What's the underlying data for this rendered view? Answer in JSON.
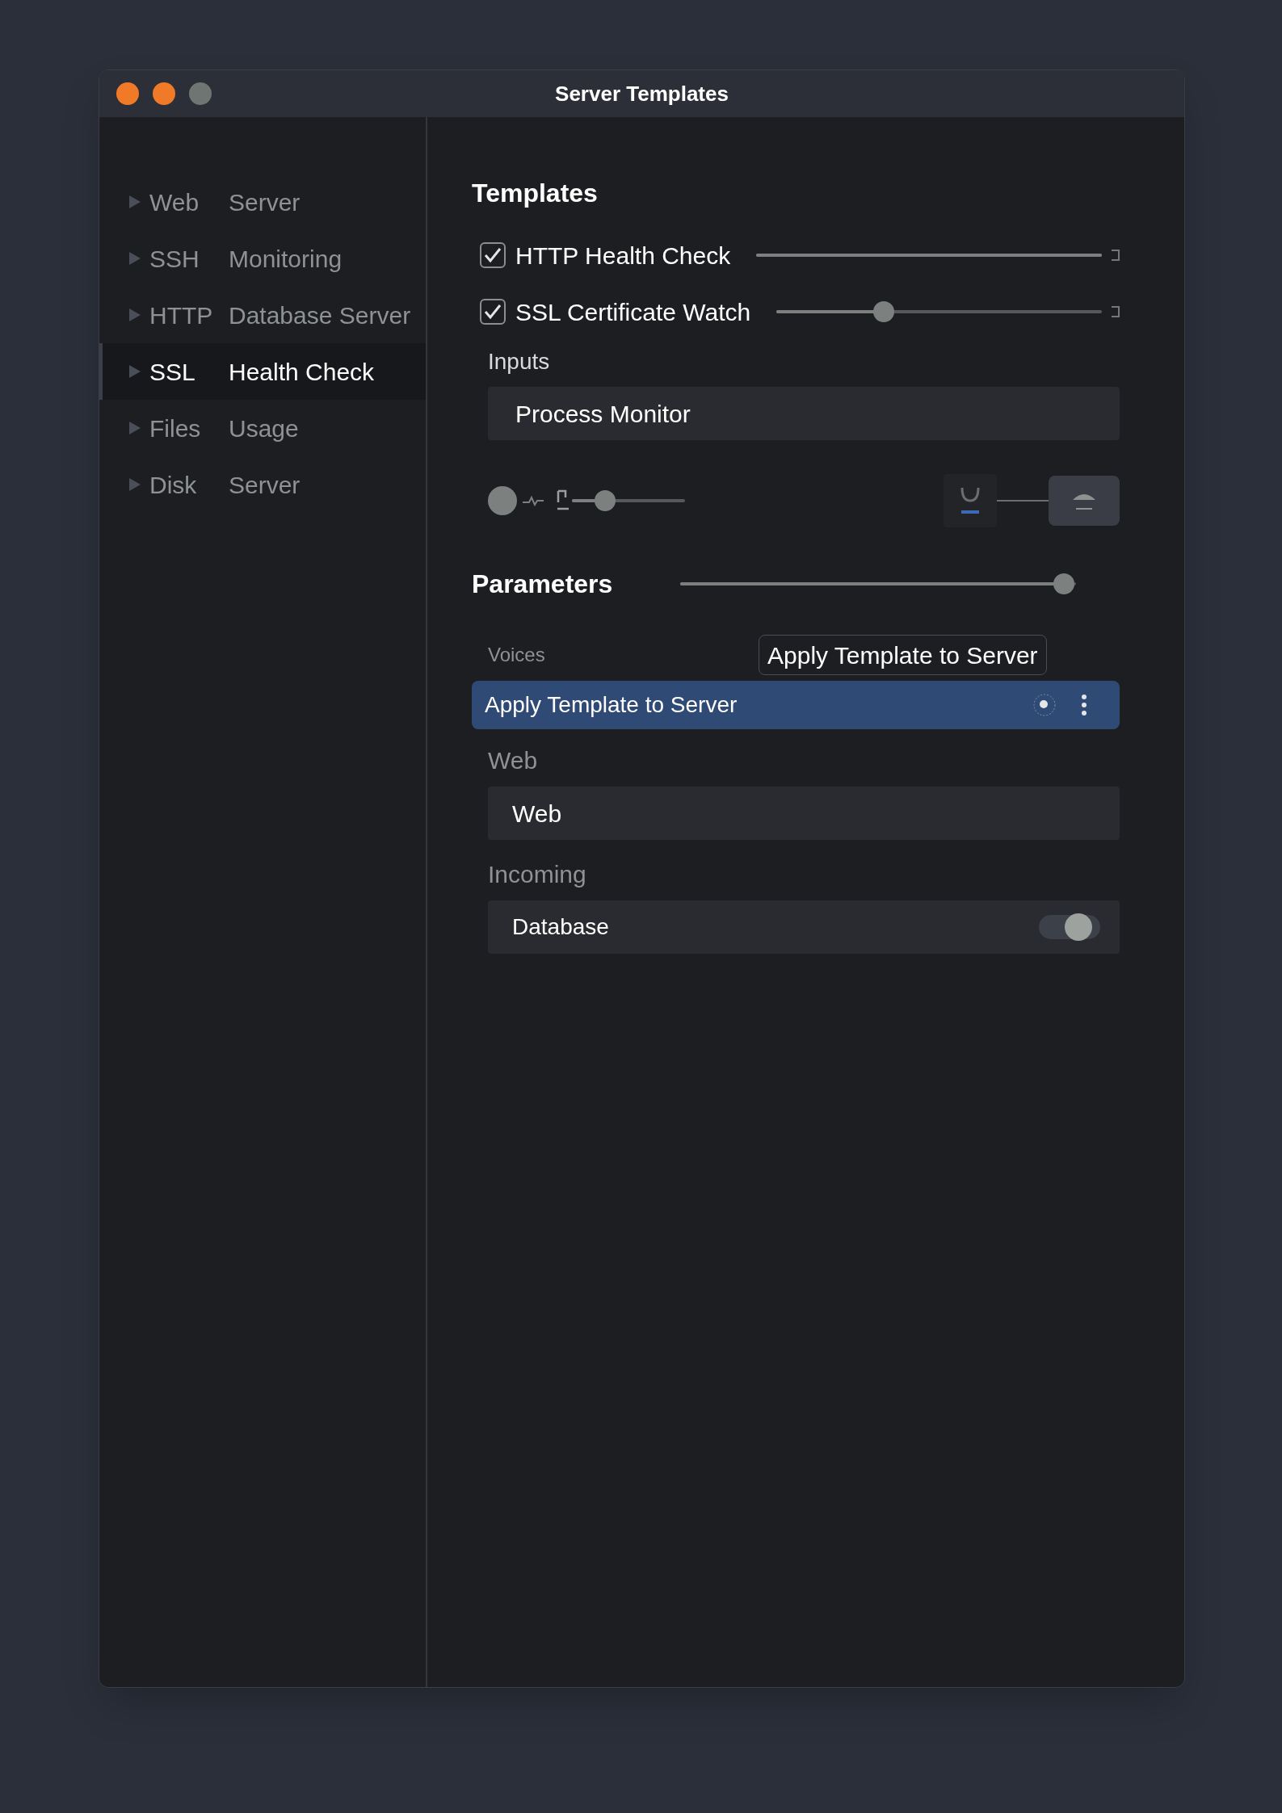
{
  "window": {
    "title": "Server Templates"
  },
  "sidebar": {
    "items": [
      {
        "prefix": "Web",
        "label": "Server",
        "selected": false
      },
      {
        "prefix": "SSH",
        "label": "Monitoring",
        "selected": false
      },
      {
        "prefix": "HTTP",
        "label": "Database Server",
        "selected": false
      },
      {
        "prefix": "SSL",
        "label": "Health Check",
        "selected": true
      },
      {
        "prefix": "Files",
        "label": "Usage",
        "selected": false
      },
      {
        "prefix": "Disk",
        "label": "Server",
        "selected": false
      }
    ]
  },
  "templates": {
    "heading": "Templates",
    "items": [
      {
        "label": "HTTP Health Check",
        "checked": true,
        "level": 1.0
      },
      {
        "label": "SSL Certificate Watch",
        "checked": true,
        "level": 0.33
      }
    ],
    "inputs_label": "Inputs",
    "input_value": "Process Monitor",
    "media_slider": {
      "level": 0.29
    }
  },
  "parameters": {
    "heading": "Parameters",
    "slider": {
      "level": 0.97
    },
    "voices_label": "Voices",
    "tooltip": "Apply Template to Server",
    "selected_row": {
      "label": "Apply Template to Server",
      "selected": true
    },
    "fields": [
      {
        "kind": "text",
        "label": "Web",
        "value": "Web"
      },
      {
        "kind": "toggle",
        "label": "Incoming",
        "value": "Database",
        "on": true
      }
    ]
  }
}
